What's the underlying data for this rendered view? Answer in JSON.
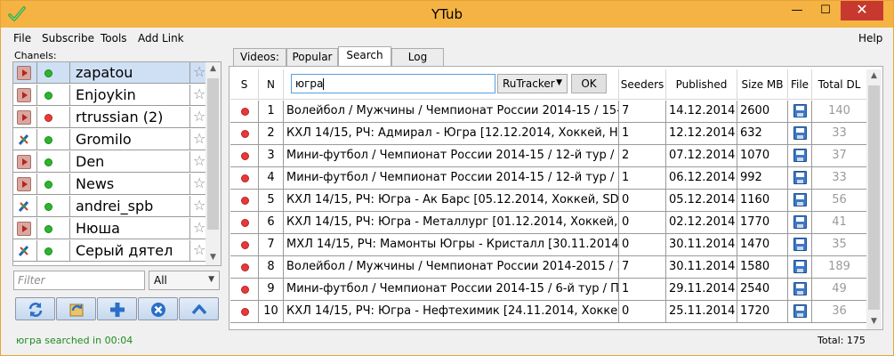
{
  "window": {
    "title": "YTub",
    "min_glyph": "—",
    "max_glyph": "☐",
    "close_glyph": "✕"
  },
  "menu": {
    "file": "File",
    "subscribe": "Subscribe",
    "tools": "Tools",
    "add_link": "Add Link",
    "help": "Help"
  },
  "channels": {
    "label": "Chanels:",
    "items": [
      {
        "name": "zapatou",
        "type": "youtube",
        "status": "green"
      },
      {
        "name": "Enjoykin",
        "type": "youtube",
        "status": "green"
      },
      {
        "name": "rtrussian (2)",
        "type": "youtube",
        "status": "red"
      },
      {
        "name": "Gromilo",
        "type": "livejournal",
        "status": "green"
      },
      {
        "name": "Den",
        "type": "youtube",
        "status": "green"
      },
      {
        "name": "News",
        "type": "youtube",
        "status": "green"
      },
      {
        "name": "andrei_spb",
        "type": "livejournal",
        "status": "green"
      },
      {
        "name": "Нюша",
        "type": "youtube",
        "status": "green"
      },
      {
        "name": "Серый дятел",
        "type": "livejournal",
        "status": "green"
      }
    ],
    "star_glyph": "☆",
    "filter_placeholder": "Filter",
    "filter_select": "All"
  },
  "tabs": {
    "videos": "Videos:",
    "popular": "Popular",
    "search": "Search",
    "log": "Log"
  },
  "search": {
    "headers": {
      "s": "S",
      "n": "N",
      "seeders": "Seeders",
      "published": "Published",
      "size": "Size MB",
      "file": "File",
      "total_dl": "Total DL"
    },
    "query": "югра",
    "tracker": "RuTracker",
    "ok": "OK",
    "rows": [
      {
        "n": "1",
        "title": "Волейбол / Мужчины / Чемпионат России 2014-15 / 15-й",
        "seeders": "7",
        "published": "14.12.2014",
        "size": "2600",
        "total_dl": "140"
      },
      {
        "n": "2",
        "title": "КХЛ 14/15, РЧ: Адмирал - Югра [12.12.2014, Хоккей, HDRip",
        "seeders": "1",
        "published": "12.12.2014",
        "size": "632",
        "total_dl": "33"
      },
      {
        "n": "3",
        "title": "Мини-футбол / Чемпионат России 2014-15 / 12-й тур / 2-",
        "seeders": "2",
        "published": "07.12.2014",
        "size": "1070",
        "total_dl": "37"
      },
      {
        "n": "4",
        "title": "Мини-футбол / Чемпионат России 2014-15 / 12-й тур / 1-",
        "seeders": "1",
        "published": "06.12.2014",
        "size": "992",
        "total_dl": "33"
      },
      {
        "n": "5",
        "title": "КХЛ 14/15, РЧ: Югра - Ак Барс [05.12.2014, Хоккей, SD/H2",
        "seeders": "0",
        "published": "05.12.2014",
        "size": "1160",
        "total_dl": "56"
      },
      {
        "n": "6",
        "title": "КХЛ 14/15, РЧ: Югра - Металлург [01.12.2014, Хоккей, SD/",
        "seeders": "0",
        "published": "02.12.2014",
        "size": "1770",
        "total_dl": "41"
      },
      {
        "n": "7",
        "title": "МХЛ 14/15, РЧ: Мамонты Югры - Кристалл [30.11.2014, Хо",
        "seeders": "0",
        "published": "30.11.2014",
        "size": "1470",
        "total_dl": "35"
      },
      {
        "n": "8",
        "title": "Волейбол / Мужчины / Чемпионат России 2014-2015 / 12",
        "seeders": "7",
        "published": "30.11.2014",
        "size": "1580",
        "total_dl": "189"
      },
      {
        "n": "9",
        "title": "Мини-футбол / Чемпионат России 2014-15 / 6-й тур / Пер",
        "seeders": "1",
        "published": "29.11.2014",
        "size": "2540",
        "total_dl": "49"
      },
      {
        "n": "10",
        "title": "КХЛ 14/15, РЧ: Югра - Нефтехимик [24.11.2014, Хоккей, SD",
        "seeders": "0",
        "published": "25.11.2014",
        "size": "1720",
        "total_dl": "36"
      }
    ]
  },
  "status": {
    "message": "югра searched in 00:04",
    "total": "Total: 175"
  },
  "colors": {
    "titlebar": "#f4b343",
    "status_green": "#1e8c1e",
    "status_red": "#e53a3a",
    "selected_row": "#cfe0f5"
  }
}
